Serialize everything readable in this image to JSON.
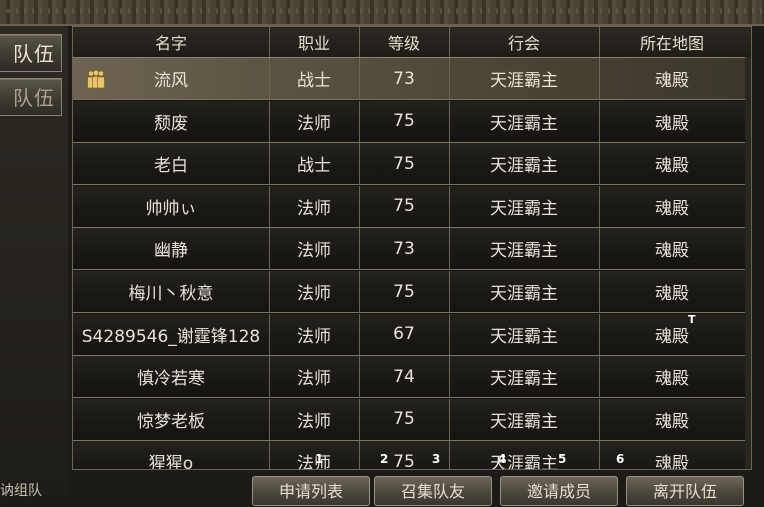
{
  "side_tabs": [
    {
      "label": "队伍"
    },
    {
      "label": "队伍"
    }
  ],
  "bottom_left_text": "讷组队",
  "table": {
    "headers": [
      "名字",
      "职业",
      "等级",
      "行会",
      "所在地图"
    ],
    "rows": [
      {
        "name": "流风",
        "class": "战士",
        "level": "73",
        "guild": "天涯霸主",
        "map": "魂殿",
        "leader": true
      },
      {
        "name": "颓废",
        "class": "法师",
        "level": "75",
        "guild": "天涯霸主",
        "map": "魂殿"
      },
      {
        "name": "老白",
        "class": "战士",
        "level": "75",
        "guild": "天涯霸主",
        "map": "魂殿"
      },
      {
        "name": "帅帅ぃ",
        "class": "法师",
        "level": "75",
        "guild": "天涯霸主",
        "map": "魂殿"
      },
      {
        "name": "幽静",
        "class": "法师",
        "level": "73",
        "guild": "天涯霸主",
        "map": "魂殿"
      },
      {
        "name": "梅川丶秋意",
        "class": "法师",
        "level": "75",
        "guild": "天涯霸主",
        "map": "魂殿"
      },
      {
        "name": "S4289546_谢霆锋128",
        "class": "法师",
        "level": "67",
        "guild": "天涯霸主",
        "map": "魂殿"
      },
      {
        "name": "慎冷若寒",
        "class": "法师",
        "level": "74",
        "guild": "天涯霸主",
        "map": "魂殿"
      },
      {
        "name": "惊梦老板",
        "class": "法师",
        "level": "75",
        "guild": "天涯霸主",
        "map": "魂殿"
      },
      {
        "name": "猩猩o",
        "class": "法师",
        "level": "75",
        "guild": "天涯霸主",
        "map": "魂殿"
      }
    ]
  },
  "buttons": [
    {
      "label": "申请列表"
    },
    {
      "label": "召集队友"
    },
    {
      "label": "邀请成员"
    },
    {
      "label": "离开队伍"
    }
  ],
  "overlay_numbers": [
    "1",
    "2",
    "3",
    "4",
    "5",
    "6"
  ],
  "cursor_text": "T",
  "colors": {
    "frame": "#6d6453",
    "selected_row": "#6d6551",
    "leader_icon": "#e9c46a",
    "text": "#e8e3d6"
  },
  "icons": {
    "leader": "leader-icon"
  }
}
